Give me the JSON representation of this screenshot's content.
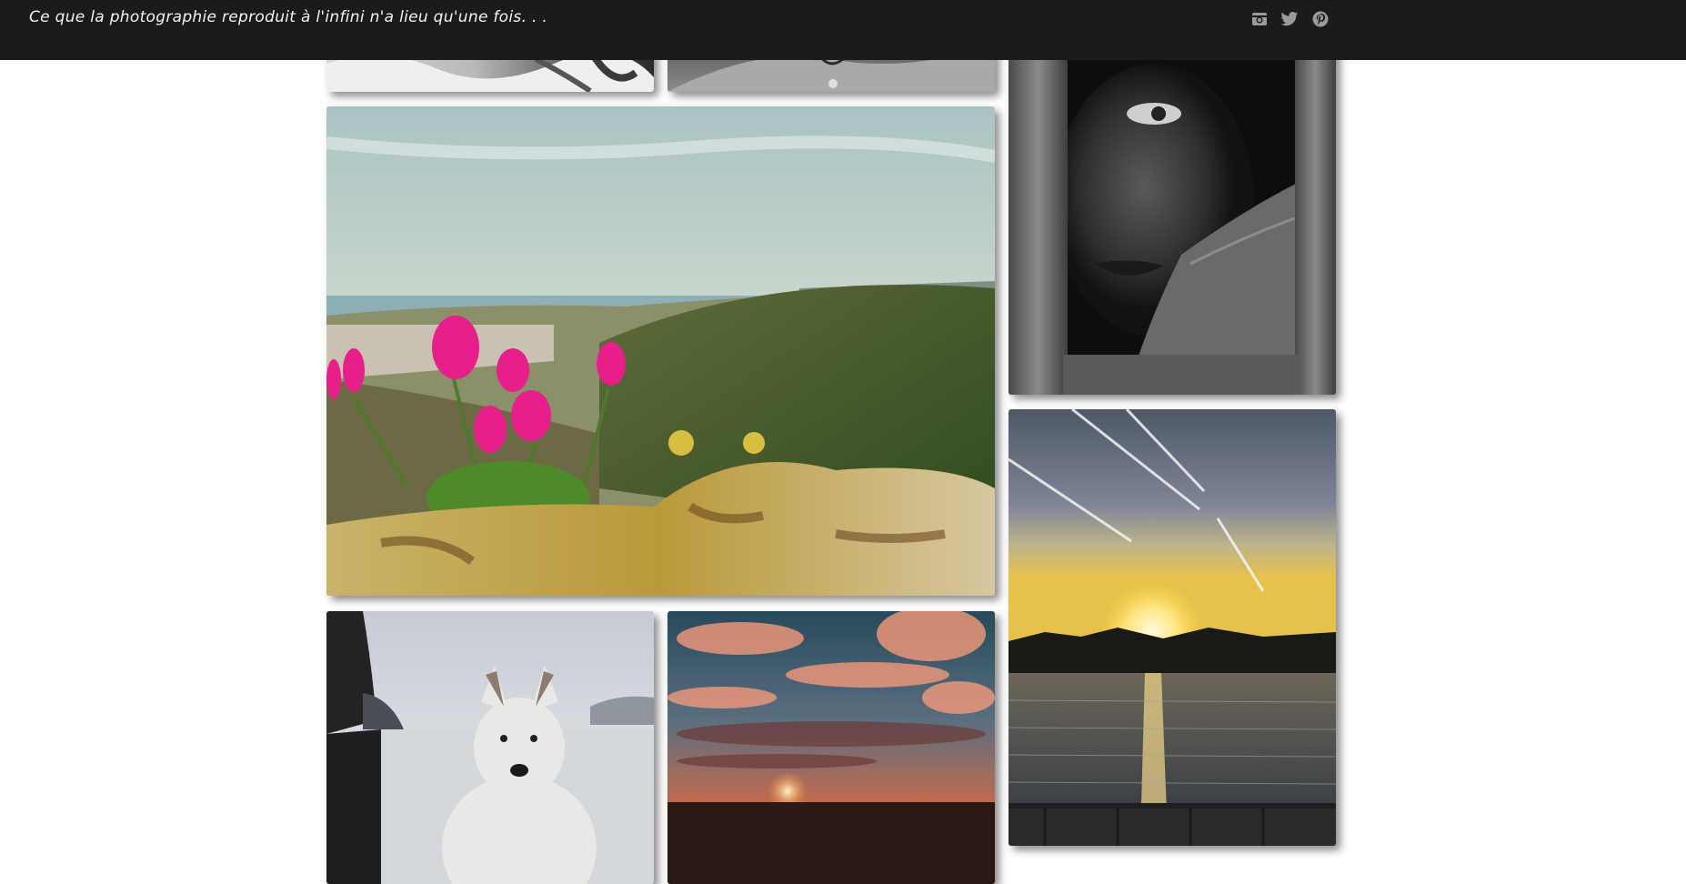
{
  "header": {
    "tagline": "Ce que la photographie reproduit à l'infini n'a lieu qu'une fois. . .",
    "social": [
      {
        "name": "instagram-icon"
      },
      {
        "name": "twitter-icon"
      },
      {
        "name": "pinterest-icon"
      }
    ]
  },
  "gallery": {
    "photos": [
      {
        "name": "photo-elderly-hands-bw"
      },
      {
        "name": "photo-necklace-bw"
      },
      {
        "name": "photo-child-tear-bw"
      },
      {
        "name": "photo-pink-flowers-landscape"
      },
      {
        "name": "photo-sunset-contrails"
      },
      {
        "name": "photo-white-dog-beach"
      },
      {
        "name": "photo-sunset-clouds"
      }
    ]
  },
  "colors": {
    "header_bg": "#1b1b1b",
    "icon": "#9a9a9a",
    "page_bg": "#ffffff"
  }
}
